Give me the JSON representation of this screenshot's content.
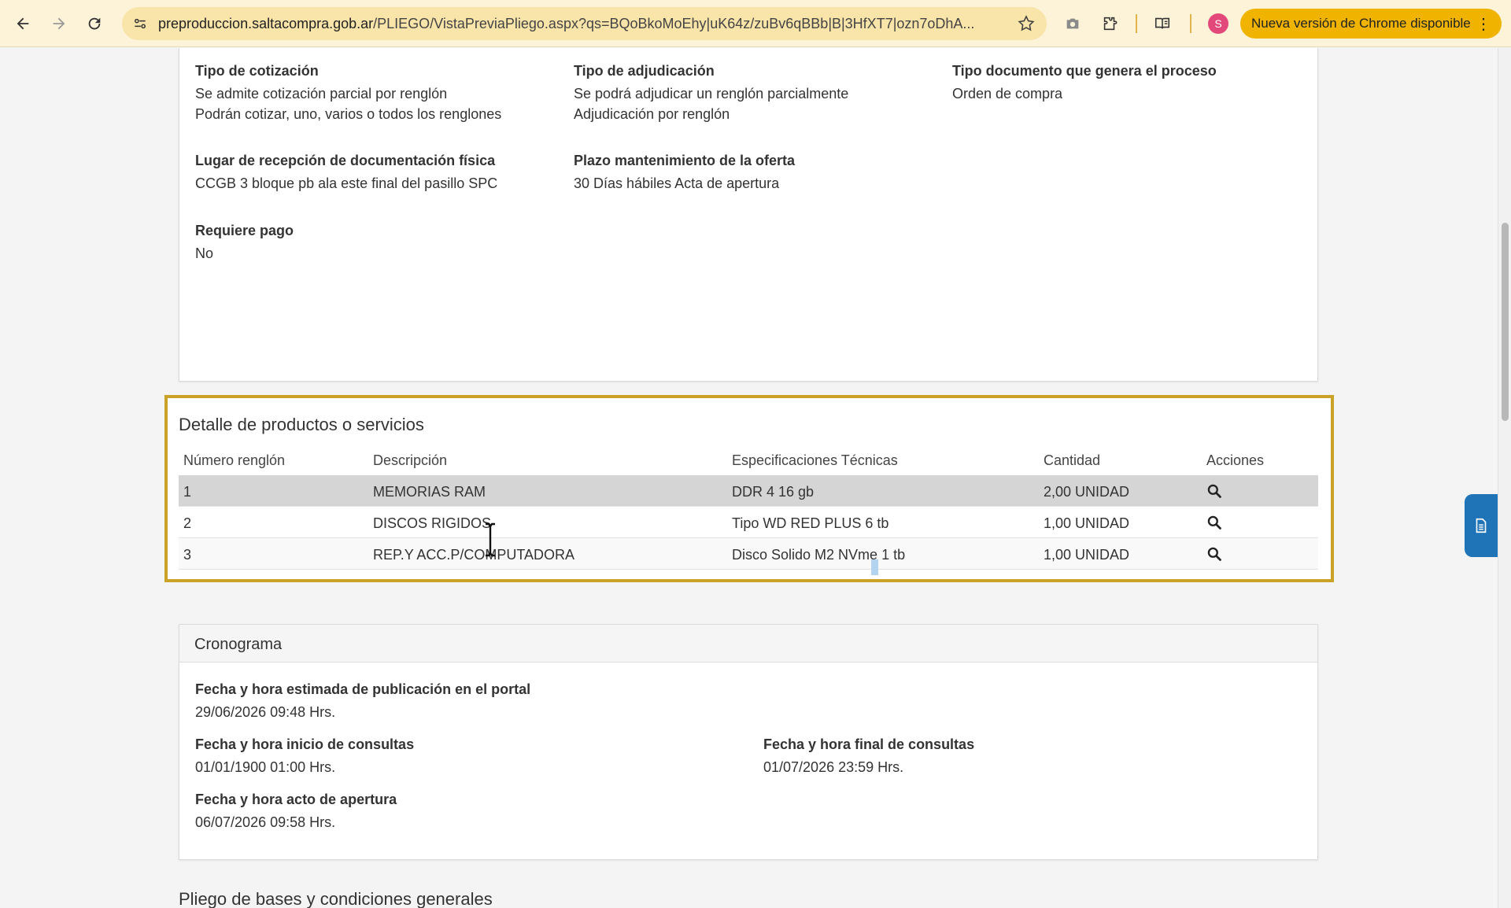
{
  "browser": {
    "url_host": "preproduccion.saltacompra.gob.ar",
    "url_path": "/PLIEGO/VistaPreviaPliego.aspx?qs=BQoBkoMoEhy|uK64z/zuBv6qBBb|B|3HfXT7|ozn7oDhA...",
    "update_label": "Nueva versión de Chrome disponible",
    "profile_initial": "S"
  },
  "details": {
    "tipo_cotizacion": {
      "label": "Tipo de cotización",
      "line1": "Se admite cotización parcial por renglón",
      "line2": "Podrán cotizar, uno, varios o todos los renglones"
    },
    "tipo_adjudicacion": {
      "label": "Tipo de adjudicación",
      "line1": "Se podrá adjudicar un renglón parcialmente",
      "line2": "Adjudicación por renglón"
    },
    "tipo_documento": {
      "label": "Tipo documento que genera el proceso",
      "value": "Orden de compra"
    },
    "lugar_recepcion": {
      "label": "Lugar de recepción de documentación física",
      "value": "CCGB 3 bloque pb ala este final del pasillo SPC"
    },
    "plazo_mantenimiento": {
      "label": "Plazo mantenimiento de la oferta",
      "value": "30 Días hábiles Acta de apertura"
    },
    "requiere_pago": {
      "label": "Requiere pago",
      "value": "No"
    }
  },
  "products": {
    "heading": "Detalle de productos o servicios",
    "columns": [
      "Número renglón",
      "Descripción",
      "Especificaciones Técnicas",
      "Cantidad",
      "Acciones"
    ],
    "rows": [
      {
        "num": "1",
        "desc": "MEMORIAS RAM",
        "spec": "DDR 4 16 gb",
        "qty": "2,00 UNIDAD"
      },
      {
        "num": "2",
        "desc": "DISCOS RIGIDOS",
        "spec": "Tipo WD RED PLUS 6 tb",
        "qty": "1,00 UNIDAD"
      },
      {
        "num": "3",
        "desc": "REP.Y ACC.P/COMPUTADORA",
        "spec": "Disco Solido M2 NVme 1 tb",
        "qty": "1,00 UNIDAD"
      }
    ]
  },
  "cronograma": {
    "heading": "Cronograma",
    "publicacion": {
      "label": "Fecha y hora estimada de publicación en el portal",
      "value": "29/06/2026 09:48 Hrs."
    },
    "inicio_consultas": {
      "label": "Fecha y hora inicio de consultas",
      "value": "01/01/1900 01:00 Hrs."
    },
    "final_consultas": {
      "label": "Fecha y hora final de consultas",
      "value": "01/07/2026 23:59 Hrs."
    },
    "acto_apertura": {
      "label": "Fecha y hora acto de apertura",
      "value": "06/07/2026 09:58 Hrs."
    }
  },
  "pliego_heading": "Pliego de bases y condiciones generales",
  "colors": {
    "highlight_border": "#c9a227",
    "toolbar_bg": "#fdf3d8",
    "update_pill": "#f0b300",
    "float_button": "#1f73b7"
  }
}
